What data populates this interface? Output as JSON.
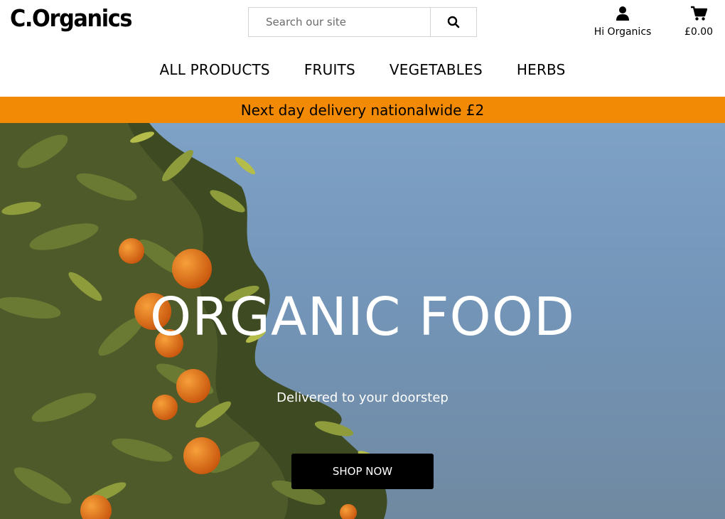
{
  "brand": {
    "logo_text": "C.Organics"
  },
  "search": {
    "placeholder": "Search our site"
  },
  "account": {
    "label": "Hi Organics",
    "icon": "user-icon"
  },
  "cart": {
    "total": "£0.00",
    "icon": "cart-icon"
  },
  "nav": {
    "items": [
      "ALL PRODUCTS",
      "FRUITS",
      "VEGETABLES",
      "HERBS"
    ]
  },
  "banner": {
    "text": "Next day delivery nationalwide £2",
    "color": "#f28a05"
  },
  "hero": {
    "title": "ORGANIC FOOD",
    "subtitle": "Delivered to your doorstep",
    "cta_label": "SHOP NOW"
  }
}
